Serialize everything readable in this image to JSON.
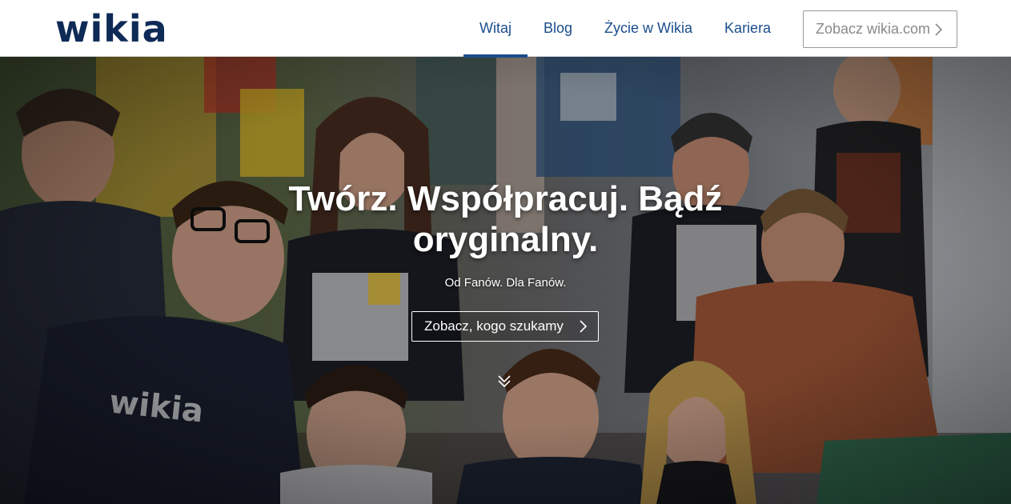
{
  "header": {
    "logo_text": "wikia",
    "nav": [
      {
        "label": "Witaj",
        "active": true
      },
      {
        "label": "Blog",
        "active": false
      },
      {
        "label": "Życie w Wikia",
        "active": false
      },
      {
        "label": "Kariera",
        "active": false
      }
    ],
    "cta_label": "Zobacz wikia.com",
    "cta_icon": "chevron-right-icon"
  },
  "hero": {
    "title_line1": "Twórz. Współpracuj. Bądź",
    "title_line2": "oryginalny.",
    "subtitle": "Od Fanów. Dla Fanów.",
    "button_label": "Zobacz, kogo szukamy",
    "button_icon": "chevron-right-icon",
    "scroll_icon": "double-chevron-down-icon",
    "shirt_print": "wikia"
  },
  "colors": {
    "brand_navy": "#0e2a56",
    "nav_link": "#1a4d8c",
    "cta_border": "#9a9a9a",
    "cta_text": "#8a8a8a"
  }
}
